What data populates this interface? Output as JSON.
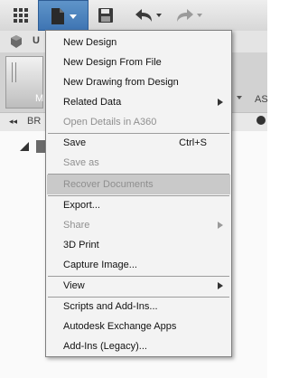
{
  "toolbar": {
    "icons": {
      "grid": "grid-icon",
      "file": "file-icon",
      "save": "floppy-disk-icon",
      "undo": "undo-icon",
      "redo": "redo-icon"
    }
  },
  "background": {
    "tab_fragment": "U",
    "ribbon_fragment": "AS",
    "ribbon_m": "M",
    "panel_fragment": "BR"
  },
  "menu": {
    "items": [
      {
        "label": "New Design"
      },
      {
        "label": "New Design From File"
      },
      {
        "label": "New Drawing from Design"
      },
      {
        "label": "Related Data",
        "submenu": true
      },
      {
        "label": "Open Details in A360",
        "disabled": true
      },
      {
        "label": "Save",
        "shortcut": "Ctrl+S"
      },
      {
        "label": "Save as",
        "disabled": true
      },
      {
        "label": "Recover Documents",
        "disabled": true,
        "highlighted": true
      },
      {
        "label": "Export..."
      },
      {
        "label": "Share",
        "disabled": true,
        "submenu": true
      },
      {
        "label": "3D Print"
      },
      {
        "label": "Capture Image..."
      },
      {
        "label": "View",
        "submenu": true
      },
      {
        "label": "Scripts and Add-Ins..."
      },
      {
        "label": "Autodesk Exchange Apps"
      },
      {
        "label": "Add-Ins (Legacy)..."
      }
    ]
  },
  "colors": {
    "file_button": "#4a7fbb",
    "highlight": "#c9c9c9"
  }
}
